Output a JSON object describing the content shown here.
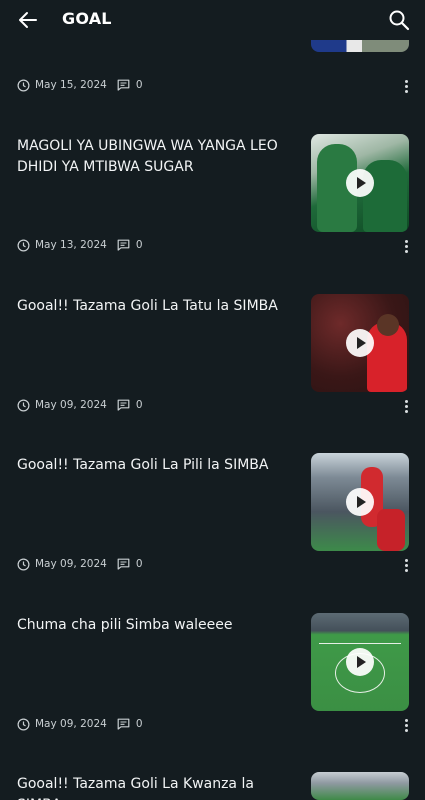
{
  "header": {
    "title": "GOAL",
    "back_icon": "arrow-left-icon",
    "search_icon": "search-icon"
  },
  "colors": {
    "background": "#141c20",
    "text": "#ffffff",
    "meta_text": "#c9cfd2"
  },
  "posts": [
    {
      "title": "",
      "date": "May 15, 2024",
      "comments": "0",
      "has_play": false
    },
    {
      "title": "MAGOLI YA UBINGWA WA YANGA LEO DHIDI YA MTIBWA SUGAR",
      "date": "May 13, 2024",
      "comments": "0",
      "has_play": true
    },
    {
      "title": "Gooal!! Tazama Goli La Tatu la SIMBA",
      "date": "May 09, 2024",
      "comments": "0",
      "has_play": true
    },
    {
      "title": "Gooal!! Tazama Goli La Pili la SIMBA",
      "date": "May 09, 2024",
      "comments": "0",
      "has_play": true
    },
    {
      "title": "Chuma cha pili Simba waleeee",
      "date": "May 09, 2024",
      "comments": "0",
      "has_play": true
    },
    {
      "title": "Gooal!! Tazama Goli La Kwanza la SIMBA",
      "date": "",
      "comments": "",
      "has_play": false
    }
  ]
}
